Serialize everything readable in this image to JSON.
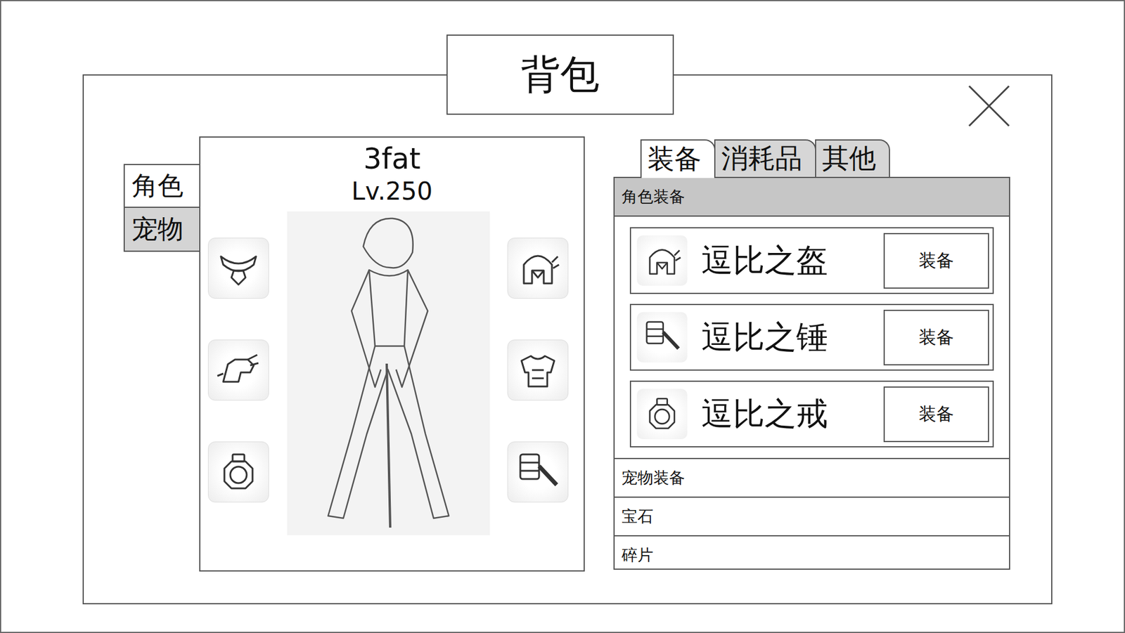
{
  "window": {
    "title": "背包"
  },
  "side_tabs": [
    {
      "label": "角色",
      "selected": true
    },
    {
      "label": "宠物",
      "selected": false
    }
  ],
  "character": {
    "name": "3fat",
    "level": "Lv.250",
    "slots_left": [
      {
        "kind": "amulet"
      },
      {
        "kind": "glove"
      },
      {
        "kind": "ring"
      }
    ],
    "slots_right": [
      {
        "kind": "helmet"
      },
      {
        "kind": "armor"
      },
      {
        "kind": "hammer"
      }
    ]
  },
  "tabs": [
    {
      "label": "装备",
      "selected": true
    },
    {
      "label": "消耗品",
      "selected": false
    },
    {
      "label": "其他",
      "selected": false
    }
  ],
  "sections": [
    {
      "label": "角色装备",
      "expanded": true,
      "items": [
        {
          "name": "逗比之盔",
          "kind": "helmet",
          "button": "装备"
        },
        {
          "name": "逗比之锤",
          "kind": "hammer",
          "button": "装备"
        },
        {
          "name": "逗比之戒",
          "kind": "ring",
          "button": "装备"
        }
      ]
    },
    {
      "label": "宠物装备",
      "expanded": false,
      "items": []
    },
    {
      "label": "宝石",
      "expanded": false,
      "items": []
    },
    {
      "label": "碎片",
      "expanded": false,
      "items": []
    }
  ]
}
